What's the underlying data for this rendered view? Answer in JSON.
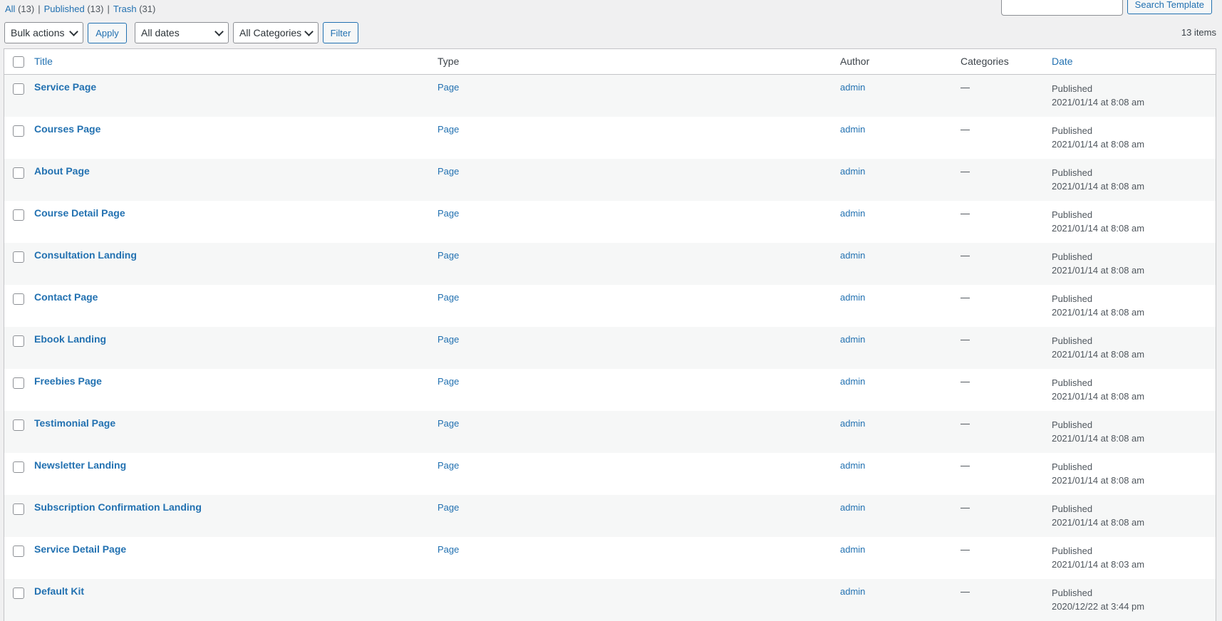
{
  "views": [
    {
      "label": "All",
      "count": "(13)"
    },
    {
      "label": "Published",
      "count": "(13)"
    },
    {
      "label": "Trash",
      "count": "(31)"
    }
  ],
  "search": {
    "button": "Search Template",
    "value": ""
  },
  "tablenav": {
    "bulk_actions": "Bulk actions",
    "apply": "Apply",
    "dates": "All dates",
    "categories": "All Categories",
    "filter": "Filter",
    "items_count": "13 items"
  },
  "columns": {
    "title": "Title",
    "type": "Type",
    "author": "Author",
    "categories": "Categories",
    "date": "Date"
  },
  "rows": [
    {
      "title": "Service Page",
      "type": "Page",
      "author": "admin",
      "categories": "—",
      "status": "Published",
      "date": "2021/01/14 at 8:08 am"
    },
    {
      "title": "Courses Page",
      "type": "Page",
      "author": "admin",
      "categories": "—",
      "status": "Published",
      "date": "2021/01/14 at 8:08 am"
    },
    {
      "title": "About Page",
      "type": "Page",
      "author": "admin",
      "categories": "—",
      "status": "Published",
      "date": "2021/01/14 at 8:08 am"
    },
    {
      "title": "Course Detail Page",
      "type": "Page",
      "author": "admin",
      "categories": "—",
      "status": "Published",
      "date": "2021/01/14 at 8:08 am"
    },
    {
      "title": "Consultation Landing",
      "type": "Page",
      "author": "admin",
      "categories": "—",
      "status": "Published",
      "date": "2021/01/14 at 8:08 am"
    },
    {
      "title": "Contact Page",
      "type": "Page",
      "author": "admin",
      "categories": "—",
      "status": "Published",
      "date": "2021/01/14 at 8:08 am"
    },
    {
      "title": "Ebook Landing",
      "type": "Page",
      "author": "admin",
      "categories": "—",
      "status": "Published",
      "date": "2021/01/14 at 8:08 am"
    },
    {
      "title": "Freebies Page",
      "type": "Page",
      "author": "admin",
      "categories": "—",
      "status": "Published",
      "date": "2021/01/14 at 8:08 am"
    },
    {
      "title": "Testimonial Page",
      "type": "Page",
      "author": "admin",
      "categories": "—",
      "status": "Published",
      "date": "2021/01/14 at 8:08 am"
    },
    {
      "title": "Newsletter Landing",
      "type": "Page",
      "author": "admin",
      "categories": "—",
      "status": "Published",
      "date": "2021/01/14 at 8:08 am"
    },
    {
      "title": "Subscription Confirmation Landing",
      "type": "Page",
      "author": "admin",
      "categories": "—",
      "status": "Published",
      "date": "2021/01/14 at 8:08 am"
    },
    {
      "title": "Service Detail Page",
      "type": "Page",
      "author": "admin",
      "categories": "—",
      "status": "Published",
      "date": "2021/01/14 at 8:03 am"
    },
    {
      "title": "Default Kit",
      "type": "",
      "author": "admin",
      "categories": "—",
      "status": "Published",
      "date": "2020/12/22 at 3:44 pm"
    }
  ]
}
